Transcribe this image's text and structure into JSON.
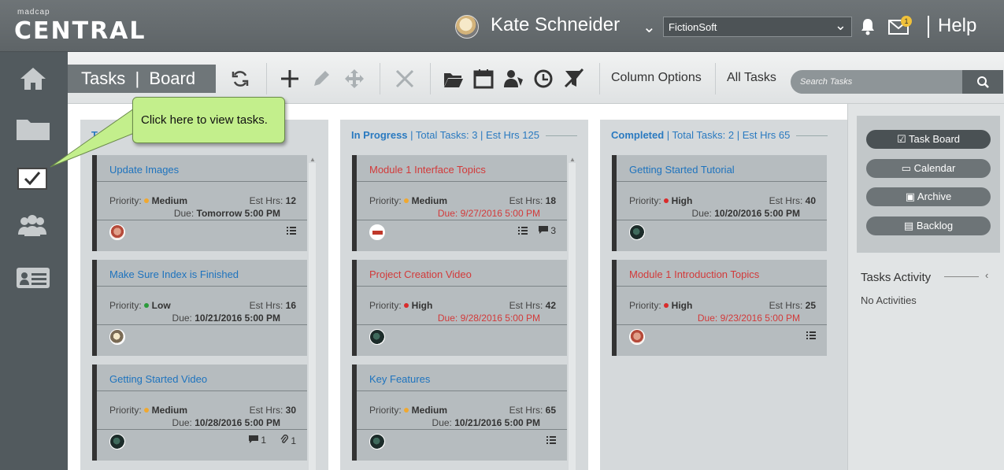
{
  "header": {
    "logo_small": "madcap",
    "logo_big": "CENTRAL",
    "user_name": "Kate Schneider",
    "org": "FictionSoft",
    "notification_count": "1",
    "help": "Help"
  },
  "toolbar": {
    "title": "Tasks  |  Board",
    "column_options": "Column Options",
    "all_tasks": "All Tasks",
    "search_placeholder": "Search Tasks"
  },
  "callout": {
    "text": "Click here to view tasks."
  },
  "columns": [
    {
      "name": "To Do",
      "cards": [
        {
          "title": "Update Images",
          "priority": "Medium",
          "priority_color": "#f0a830",
          "est": "12",
          "due": "Tomorrow 5:00 PM",
          "overdue": false
        },
        {
          "title": "Make Sure Index is Finished",
          "priority": "Low",
          "priority_color": "#2a9a3a",
          "est": "16",
          "due": "10/21/2016 5:00 PM",
          "overdue": false
        },
        {
          "title": "Getting Started Video",
          "priority": "Medium",
          "priority_color": "#f0a830",
          "est": "30",
          "due": "10/28/2016 5:00 PM",
          "overdue": false,
          "comments": "1",
          "attachments": "1"
        }
      ]
    },
    {
      "name": "In Progress",
      "total_label": "Total Tasks: 3",
      "hours_label": "Est Hrs 125",
      "cards": [
        {
          "title": "Module 1 Interface Topics",
          "priority": "Medium",
          "priority_color": "#f0a830",
          "est": "18",
          "due": "9/27/2016 5:00 PM",
          "overdue": true,
          "comments": "3"
        },
        {
          "title": "Project Creation Video",
          "priority": "High",
          "priority_color": "#d92b2b",
          "est": "42",
          "due": "9/28/2016 5:00 PM",
          "overdue": true
        },
        {
          "title": "Key Features",
          "priority": "Medium",
          "priority_color": "#f0a830",
          "est": "65",
          "due": "10/21/2016 5:00 PM",
          "overdue": false
        }
      ]
    },
    {
      "name": "Completed",
      "total_label": "Total Tasks: 2",
      "hours_label": "Est Hrs 65",
      "cards": [
        {
          "title": "Getting Started Tutorial",
          "priority": "High",
          "priority_color": "#d92b2b",
          "est": "40",
          "due": "10/20/2016 5:00 PM",
          "overdue": false
        },
        {
          "title": "Module 1 Introduction Topics",
          "priority": "High",
          "priority_color": "#d92b2b",
          "est": "25",
          "due": "9/23/2016 5:00 PM",
          "overdue": true
        }
      ]
    }
  ],
  "labels": {
    "priority": "Priority:",
    "est": "Est Hrs:",
    "due": "Due:"
  },
  "views": [
    "Task Board",
    "Calendar",
    "Archive",
    "Backlog"
  ],
  "activity": {
    "title": "Tasks Activity",
    "empty": "No Activities"
  }
}
